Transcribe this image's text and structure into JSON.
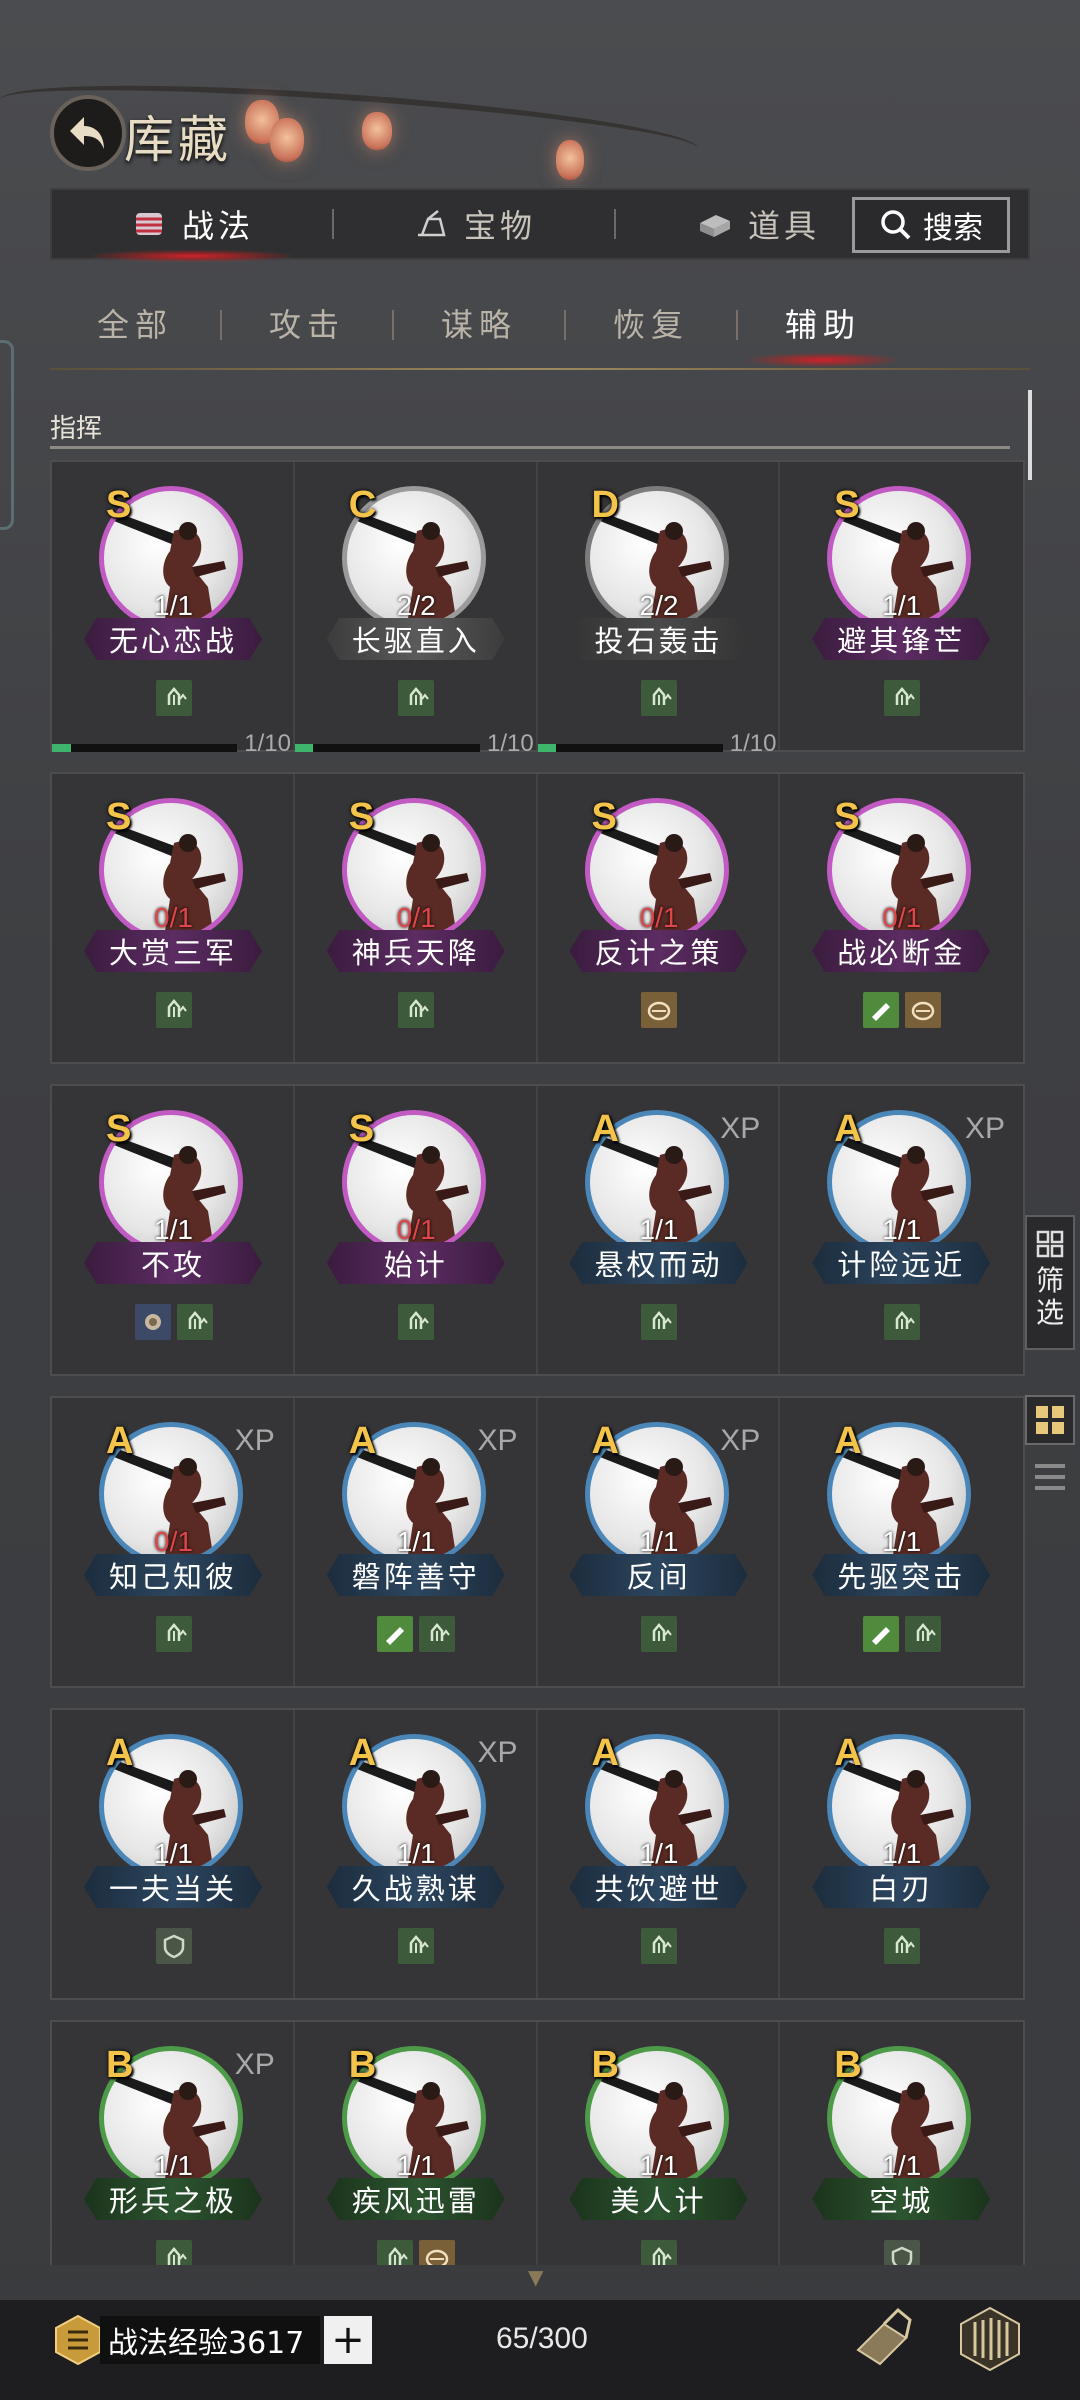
{
  "header": {
    "title": "库藏"
  },
  "top_tabs": [
    {
      "label": "战法",
      "icon": "scroll-bundle-icon",
      "active": true
    },
    {
      "label": "宝物",
      "icon": "treasure-icon",
      "active": false
    },
    {
      "label": "道具",
      "icon": "item-chest-icon",
      "active": false
    }
  ],
  "search": {
    "label": "搜索"
  },
  "sub_tabs": [
    {
      "label": "全部",
      "active": false
    },
    {
      "label": "攻击",
      "active": false
    },
    {
      "label": "谋略",
      "active": false
    },
    {
      "label": "恢复",
      "active": false
    },
    {
      "label": "辅助",
      "active": true
    }
  ],
  "section": {
    "label": "指挥"
  },
  "rows": [
    [
      {
        "grade": "S",
        "count": "1/1",
        "red": false,
        "name": "无心恋战",
        "xp": "",
        "tags": [
          "green"
        ],
        "progress": "1/10",
        "progress_fraction": 0.1
      },
      {
        "grade": "C",
        "count": "2/2",
        "red": false,
        "name": "长驱直入",
        "xp": "",
        "tags": [
          "green"
        ],
        "progress": "1/10",
        "progress_fraction": 0.1
      },
      {
        "grade": "D",
        "count": "2/2",
        "red": false,
        "name": "投石轰击",
        "xp": "",
        "tags": [
          "green"
        ],
        "progress": "1/10",
        "progress_fraction": 0.1
      },
      {
        "grade": "S",
        "count": "1/1",
        "red": false,
        "name": "避其锋芒",
        "xp": "",
        "tags": [
          "green"
        ],
        "progress": "",
        "progress_fraction": 0
      }
    ],
    [
      {
        "grade": "S",
        "count": "0/1",
        "red": true,
        "name": "大赏三军",
        "xp": "",
        "tags": [
          "green"
        ]
      },
      {
        "grade": "S",
        "count": "0/1",
        "red": true,
        "name": "神兵天降",
        "xp": "",
        "tags": [
          "green"
        ]
      },
      {
        "grade": "S",
        "count": "0/1",
        "red": true,
        "name": "反计之策",
        "xp": "",
        "tags": [
          "gold"
        ]
      },
      {
        "grade": "S",
        "count": "0/1",
        "red": true,
        "name": "战必断金",
        "xp": "",
        "tags": [
          "bright",
          "gold"
        ]
      }
    ],
    [
      {
        "grade": "S",
        "count": "1/1",
        "red": false,
        "name": "不攻",
        "xp": "",
        "tags": [
          "blue",
          "green"
        ]
      },
      {
        "grade": "S",
        "count": "0/1",
        "red": true,
        "name": "始计",
        "xp": "",
        "tags": [
          "green"
        ]
      },
      {
        "grade": "A",
        "count": "1/1",
        "red": false,
        "name": "悬权而动",
        "xp": "XP",
        "tags": [
          "green"
        ]
      },
      {
        "grade": "A",
        "count": "1/1",
        "red": false,
        "name": "计险远近",
        "xp": "XP",
        "tags": [
          "green"
        ]
      }
    ],
    [
      {
        "grade": "A",
        "count": "0/1",
        "red": true,
        "name": "知己知彼",
        "xp": "XP",
        "tags": [
          "green"
        ]
      },
      {
        "grade": "A",
        "count": "1/1",
        "red": false,
        "name": "磐阵善守",
        "xp": "XP",
        "tags": [
          "bright",
          "green"
        ]
      },
      {
        "grade": "A",
        "count": "1/1",
        "red": false,
        "name": "反间",
        "xp": "XP",
        "tags": [
          "green"
        ]
      },
      {
        "grade": "A",
        "count": "1/1",
        "red": false,
        "name": "先驱突击",
        "xp": "",
        "tags": [
          "bright",
          "green"
        ]
      }
    ],
    [
      {
        "grade": "A",
        "count": "1/1",
        "red": false,
        "name": "一夫当关",
        "xp": "",
        "tags": [
          "grey"
        ]
      },
      {
        "grade": "A",
        "count": "1/1",
        "red": false,
        "name": "久战熟谋",
        "xp": "XP",
        "tags": [
          "green"
        ]
      },
      {
        "grade": "A",
        "count": "1/1",
        "red": false,
        "name": "共饮避世",
        "xp": "",
        "tags": [
          "green"
        ]
      },
      {
        "grade": "A",
        "count": "1/1",
        "red": false,
        "name": "白刃",
        "xp": "",
        "tags": [
          "green"
        ]
      }
    ],
    [
      {
        "grade": "B",
        "count": "1/1",
        "red": false,
        "name": "形兵之极",
        "xp": "XP",
        "tags": [
          "green"
        ]
      },
      {
        "grade": "B",
        "count": "1/1",
        "red": false,
        "name": "疾风迅雷",
        "xp": "",
        "tags": [
          "green",
          "gold"
        ]
      },
      {
        "grade": "B",
        "count": "1/1",
        "red": false,
        "name": "美人计",
        "xp": "",
        "tags": [
          "green"
        ]
      },
      {
        "grade": "B",
        "count": "1/1",
        "red": false,
        "name": "空城",
        "xp": "",
        "tags": [
          "grey"
        ]
      }
    ]
  ],
  "side": {
    "filter_label": "筛选"
  },
  "bottom": {
    "exp_label": "战法经验3617",
    "plus": "+",
    "capacity": "65/300"
  },
  "colors": {
    "accent_red": "#d2222a",
    "grade_gold": "#f3c34a",
    "S": "#c25ac4",
    "A": "#4a86b8",
    "B": "#4d9a48"
  }
}
